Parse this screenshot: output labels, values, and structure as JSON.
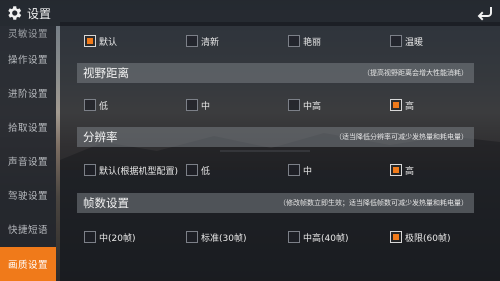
{
  "window": {
    "title": "设置"
  },
  "sidebar": {
    "items": [
      {
        "label": "灵敏设置",
        "active": false
      },
      {
        "label": "操作设置",
        "active": false
      },
      {
        "label": "进阶设置",
        "active": false
      },
      {
        "label": "拾取设置",
        "active": false
      },
      {
        "label": "声音设置",
        "active": false
      },
      {
        "label": "驾驶设置",
        "active": false
      },
      {
        "label": "快捷短语",
        "active": false
      },
      {
        "label": "画质设置",
        "active": true
      }
    ]
  },
  "sections": {
    "style": {
      "options": [
        {
          "label": "默认",
          "checked": true
        },
        {
          "label": "清新",
          "checked": false
        },
        {
          "label": "艳丽",
          "checked": false
        },
        {
          "label": "温暖",
          "checked": false
        }
      ]
    },
    "view_distance": {
      "title": "视野距离",
      "note": "（提高视野距离会增大性能消耗）",
      "options": [
        {
          "label": "低",
          "checked": false
        },
        {
          "label": "中",
          "checked": false
        },
        {
          "label": "中高",
          "checked": false
        },
        {
          "label": "高",
          "checked": true
        }
      ]
    },
    "resolution": {
      "title": "分辨率",
      "note": "（适当降低分辨率可减少发热量和耗电量）",
      "options": [
        {
          "label": "默认(根据机型配置)",
          "checked": false
        },
        {
          "label": "低",
          "checked": false
        },
        {
          "label": "中",
          "checked": false
        },
        {
          "label": "高",
          "checked": true
        }
      ]
    },
    "frame_rate": {
      "title": "帧数设置",
      "note": "（修改帧数立即生效；适当降低帧数可减少发热量和耗电量）",
      "options": [
        {
          "label": "中(20帧)",
          "checked": false
        },
        {
          "label": "标准(30帧)",
          "checked": false
        },
        {
          "label": "中高(40帧)",
          "checked": false
        },
        {
          "label": "极限(60帧)",
          "checked": true
        }
      ]
    }
  },
  "colors": {
    "accent": "#f07a1a",
    "sidebar_bg": "#23262c",
    "header_bg": "#787d84"
  },
  "icons": {
    "settings": "gear-icon",
    "back": "back-arrow-icon"
  }
}
